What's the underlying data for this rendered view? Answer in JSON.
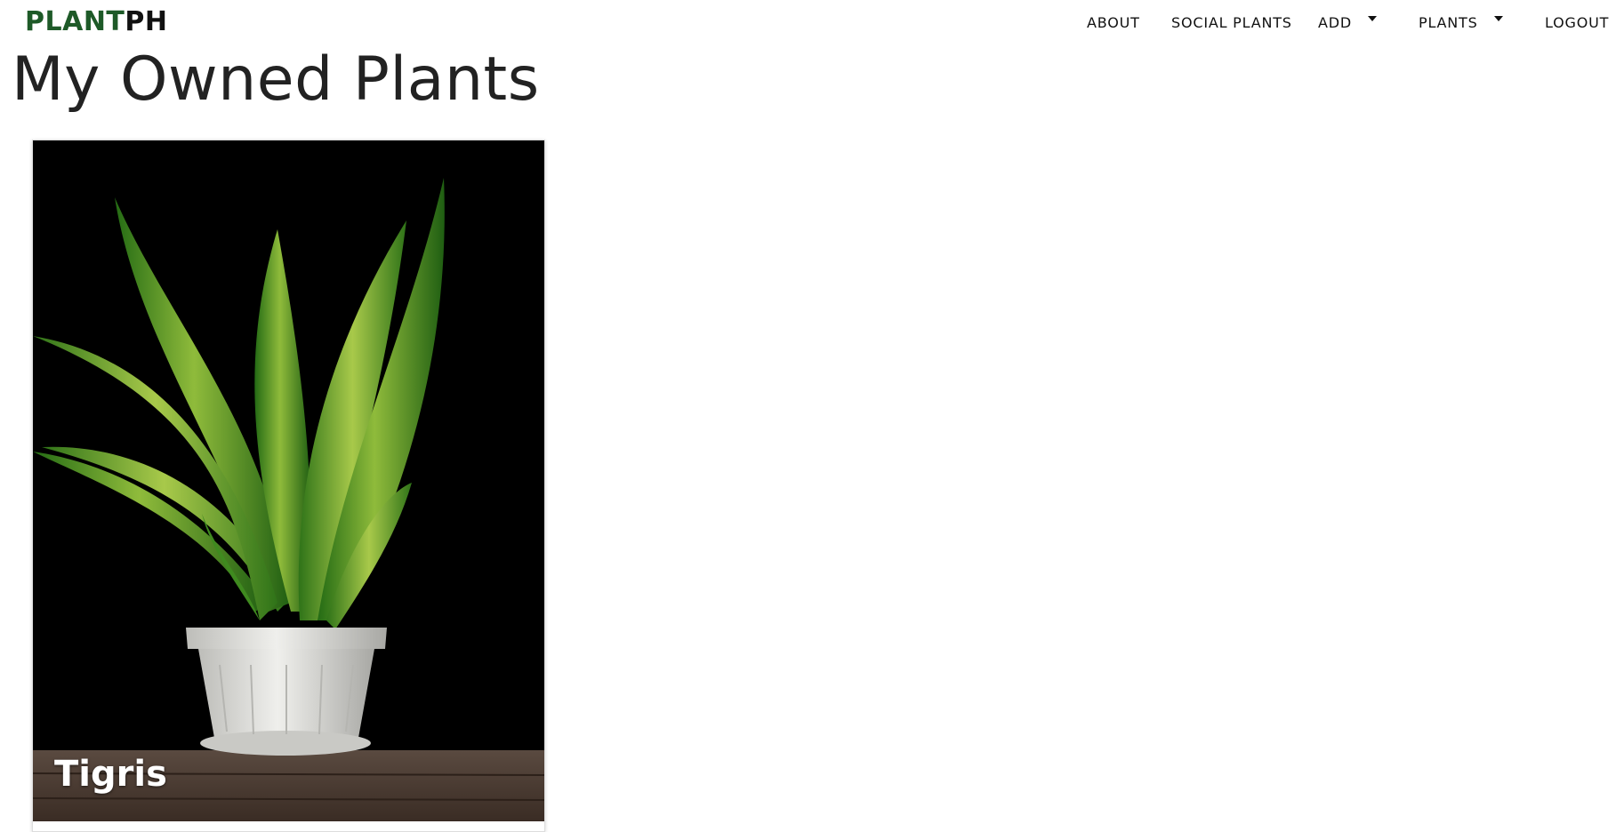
{
  "brand": {
    "part1": "PLANT",
    "part2": "PH"
  },
  "nav": {
    "about": "ABOUT",
    "social_plants": "SOCIAL PLANTS",
    "add": "ADD",
    "plants": "PLANTS",
    "logout": "LOGOUT"
  },
  "page": {
    "title": "My Owned Plants"
  },
  "plants": [
    {
      "name": "Tigris",
      "image_icon": "snake-plant-photo"
    }
  ],
  "colors": {
    "brand_green": "#1e5a28",
    "leaf_green": "#3f8a1f",
    "leaf_light": "#a8c94a",
    "pot": "#d9d9d6",
    "table": "#4a3a30"
  }
}
